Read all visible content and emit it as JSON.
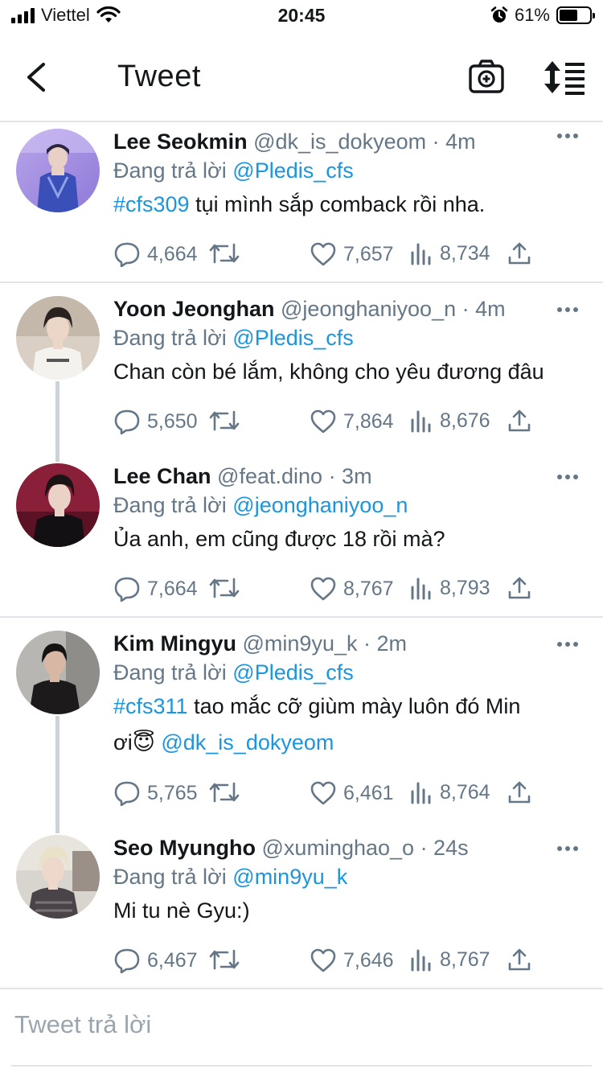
{
  "status_bar": {
    "carrier": "Viettel",
    "time": "20:45",
    "battery_percent": "61%",
    "battery_level": 0.61,
    "icons": [
      "signal-icon",
      "wifi-icon",
      "alarm-icon",
      "battery-icon"
    ]
  },
  "header": {
    "title": "Tweet",
    "icons": [
      "back-arrow-icon",
      "camera-plus-icon",
      "sort-icon"
    ]
  },
  "tweets": [
    {
      "name": "Lee Seokmin",
      "handle": "@dk_is_dokyeom",
      "time": "· 4m",
      "reply_label": "Đang trả lời",
      "reply_to": "@Pledis_cfs",
      "hashtag": "#cfs309",
      "text": " tụi mình sắp comback rồi nha.",
      "text2": "",
      "mention": "",
      "replies": "4,664",
      "likes": "7,657",
      "views": "8,734"
    },
    {
      "name": "Yoon Jeonghan",
      "handle": "@jeonghaniyoo_n",
      "time": "· 4m",
      "reply_label": "Đang trả lời",
      "reply_to": "@Pledis_cfs",
      "hashtag": "",
      "text": "Chan còn bé lắm, không cho yêu đương đâu",
      "text2": "",
      "mention": "",
      "replies": "5,650",
      "likes": "7,864",
      "views": "8,676"
    },
    {
      "name": "Lee Chan",
      "handle": "@feat.dino",
      "time": "· 3m",
      "reply_label": "Đang trả lời",
      "reply_to": "@jeonghaniyoo_n",
      "hashtag": "",
      "text": "Ủa anh, em cũng được 18 rồi mà?",
      "text2": "",
      "mention": "",
      "replies": "7,664",
      "likes": "8,767",
      "views": "8,793"
    },
    {
      "name": "Kim Mingyu",
      "handle": "@min9yu_k",
      "time": "· 2m",
      "reply_label": "Đang trả lời",
      "reply_to": "@Pledis_cfs",
      "hashtag": "#cfs311",
      "text": " tao mắc cỡ giùm mày luôn đó Min",
      "text2": "ơi😇 ",
      "mention": "@dk_is_dokyeom",
      "replies": "5,765",
      "likes": "6,461",
      "views": "8,764"
    },
    {
      "name": "Seo Myungho",
      "handle": "@xuminghao_o",
      "time": "· 24s",
      "reply_label": "Đang trả lời",
      "reply_to": "@min9yu_k",
      "hashtag": "",
      "text": "Mi tu nè Gyu:)",
      "text2": "",
      "mention": "",
      "replies": "6,467",
      "likes": "7,646",
      "views": "8,767"
    }
  ],
  "reply_box": {
    "placeholder": "Tweet trả lời"
  },
  "colors": {
    "link": "#1b95e0",
    "meta": "#657786",
    "divider": "#e1e4e8"
  }
}
